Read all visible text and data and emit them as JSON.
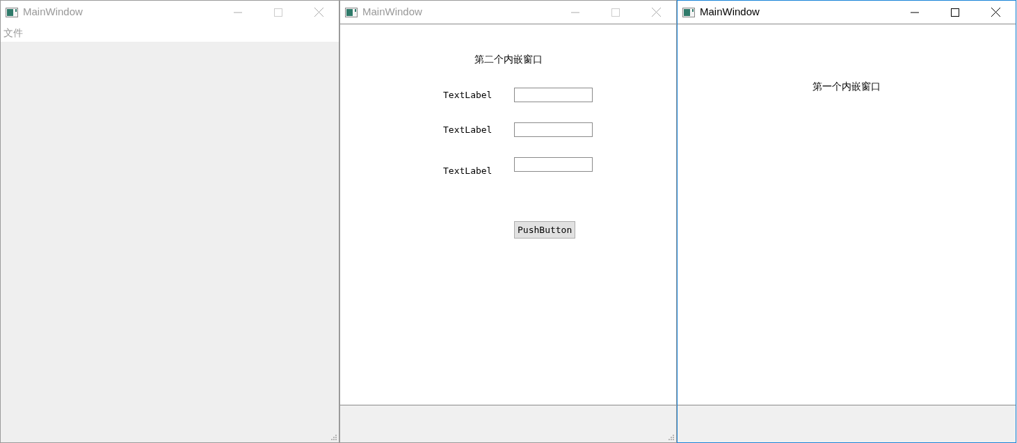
{
  "windows": [
    {
      "title": "MainWindow",
      "active": false,
      "size_grip": true,
      "menu": [
        "文件"
      ]
    },
    {
      "title": "MainWindow",
      "active": false,
      "size_grip": true,
      "content": {
        "heading": "第二个内嵌窗口",
        "fields": [
          {
            "label": "TextLabel"
          },
          {
            "label": "TextLabel"
          },
          {
            "label": "TextLabel"
          }
        ],
        "button": "PushButton"
      }
    },
    {
      "title": "MainWindow",
      "active": true,
      "size_grip": false,
      "content": {
        "heading": "第一个内嵌窗口"
      }
    }
  ]
}
